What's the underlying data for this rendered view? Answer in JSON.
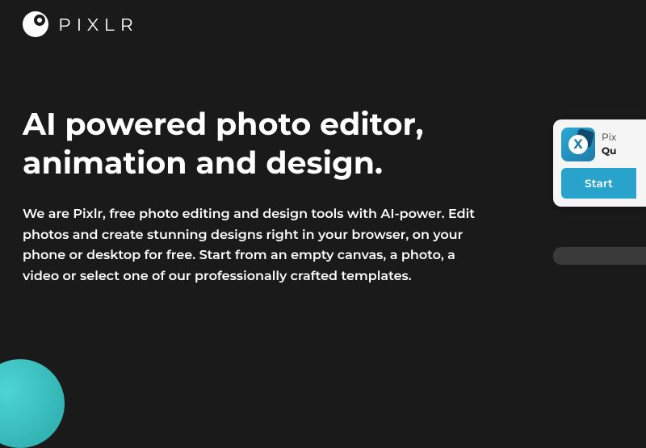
{
  "brand": {
    "name": "PIXLR"
  },
  "hero": {
    "title": "AI powered photo editor, animation and design.",
    "description": "We are Pixlr, free photo editing and design tools with AI-power. Edit photos and create stunning designs right in your browser, on your phone or desktop for free. Start from an empty canvas, a photo, a video or select one of our professionally crafted templates."
  },
  "side": {
    "card_x": {
      "icon_letter": "X",
      "line1": "Pix",
      "line2": "Qu",
      "button": "Start"
    }
  }
}
